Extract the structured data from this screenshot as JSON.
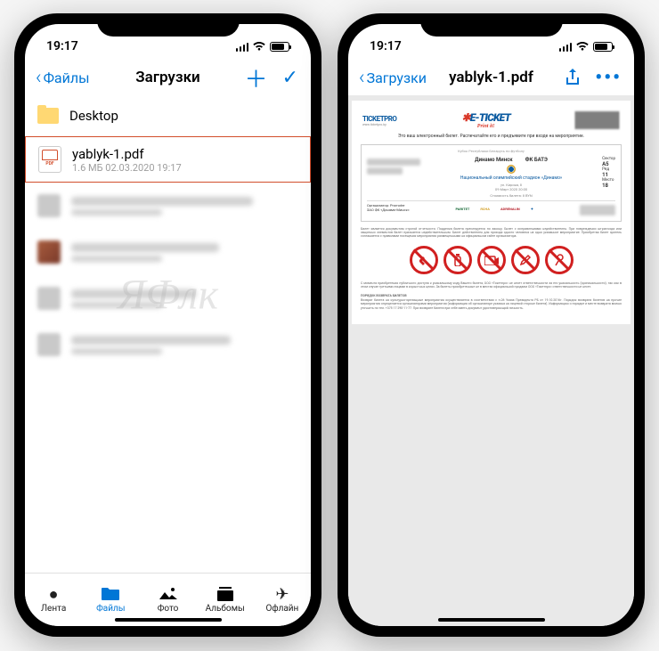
{
  "status": {
    "time": "19:17"
  },
  "left": {
    "back": "Файлы",
    "title": "Загрузки",
    "folder": {
      "name": "Desktop"
    },
    "file": {
      "name": "yablyk-1.pdf",
      "meta": "1.6 МБ  02.03.2020 19:17"
    },
    "tabs": {
      "feed": "Лента",
      "files": "Файлы",
      "photo": "Фото",
      "albums": "Альбомы",
      "offline": "Офлайн"
    }
  },
  "right": {
    "back": "Загрузки",
    "title": "yablyk-1.pdf"
  },
  "ticket": {
    "brand1": "TICKETPRO",
    "brand2": "E-TICKET",
    "print": "Print it!",
    "intro": "Это ваш электронный билет. Распечатайте его и предъявите при входе на мероприятие.",
    "cup": "Кубок Республики Беларусь по футболу",
    "team1": "Динамо Минск",
    "team2": "ФК БАТЭ",
    "stadium": "Национальный олимпийский стадион «Динамо»",
    "addr": "ул. Кирова, 8",
    "date": "09 Март 2020 20:00",
    "price": "Стоимость билета: 8   BYN",
    "sector_l": "Сектор",
    "sector_v": "A5",
    "row_l": "Ряд",
    "row_v": "11",
    "seat_l": "Место",
    "seat_v": "18",
    "org": "Организатор: Promoter",
    "org2": "ЗАО ФК «Динамо-Минск»",
    "rules1": "Билет является документом строгой отчетности. Подделка билета преследуется по закону. Билет с исправлениями недействителен. При повреждении штрих-кода или защитных элементов билет признается недействительным. Билет действителен для прохода одного человека на одно указанное мероприятие. Приобретая билет зритель соглашается с правилами посещения мероприятия размещенными на официальном сайте организатора.",
    "rules2": "С момента приобретения публичного доступа к уникальному коду Вашего билета, ООО «Тикетпро» не несет ответственности за его уникальность (оригинальности), так как в этом случае третьими лицами в корыстных целях. За билеты приобретенные не в местах официальной продажи ООО «Тикетпро» ответственности не несет.",
    "return_title": "ПОРЯДОК ВОЗВРАТА БИЛЕТОВ",
    "rules3": "Возврат билета на культурно-зрелищные мероприятия осуществляется в соответствии с п.26 Указа Президента РБ от 19.10.2016г. Порядок возврата билетов на прочие мероприятия определяется организаторами мероприятия (информация об организаторе указана на лицевой стороне билета). Информацию о порядке и месте возврата можно уточнить по тел. +375 17 290-11-77. При возврате билета при себе иметь документ удостоверяющий личность."
  },
  "watermark": "ЯФлк"
}
